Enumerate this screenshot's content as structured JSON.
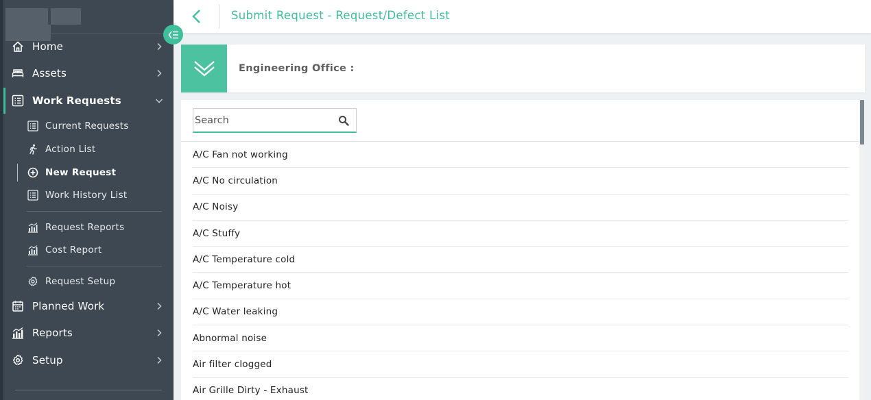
{
  "header": {
    "title": "Submit Request - Request/Defect List"
  },
  "sidebar": {
    "items": [
      {
        "label": "Home",
        "icon": "home-icon"
      },
      {
        "label": "Assets",
        "icon": "bed-icon"
      },
      {
        "label": "Work Requests",
        "icon": "list-icon",
        "expanded": true
      },
      {
        "label": "Planned Work",
        "icon": "calendar-icon"
      },
      {
        "label": "Reports",
        "icon": "bar-chart-icon"
      },
      {
        "label": "Setup",
        "icon": "gear-icon"
      }
    ],
    "work_request_sub": [
      {
        "label": "Current Requests",
        "icon": "list-icon"
      },
      {
        "label": "Action List",
        "icon": "running-person-icon"
      },
      {
        "label": "New Request",
        "icon": "plus-circle-icon",
        "current": true
      },
      {
        "label": "Work History List",
        "icon": "list-icon"
      },
      {
        "label": "Request Reports",
        "icon": "bar-chart-icon"
      },
      {
        "label": "Cost Report",
        "icon": "bar-chart-icon"
      },
      {
        "label": "Request Setup",
        "icon": "gear-icon"
      }
    ]
  },
  "office": {
    "label": "Engineering Office :"
  },
  "search": {
    "placeholder": "Search",
    "value": ""
  },
  "defects": [
    "A/C Fan not working",
    "A/C No circulation",
    "A/C Noisy",
    "A/C Stuffy",
    "A/C Temperature cold",
    "A/C Temperature hot",
    "A/C Water leaking",
    "Abnormal noise",
    "Air filter clogged",
    "Air Grille Dirty - Exhaust"
  ],
  "colors": {
    "accent": "#3fbf9b",
    "sidebar_bg": "#3d4852",
    "page_bg": "#eef1f4"
  }
}
